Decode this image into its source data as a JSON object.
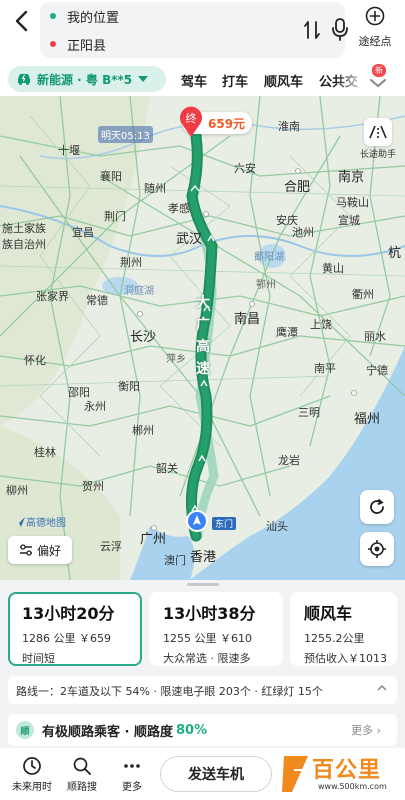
{
  "search": {
    "origin": "我的位置",
    "destination": "正阳县",
    "waypoint_label": "途经点"
  },
  "modes": {
    "vehicle": "新能源 · 粤 B**5",
    "tabs": [
      "驾车",
      "打车",
      "顺风车",
      "公共交"
    ],
    "badge": "新"
  },
  "map": {
    "weather": "明天05:13",
    "dest_tag": "659元",
    "dest_pin_char": "终",
    "long_help": "长途助手",
    "highway": [
      "大",
      "广",
      "高",
      "速"
    ],
    "pref_label": "偏好",
    "amap_logo": "高德地图",
    "dongmen": "东门",
    "cities": [
      {
        "name": "淮南",
        "cls": "city"
      },
      {
        "name": "十堰",
        "cls": "city"
      },
      {
        "name": "随州",
        "cls": "city"
      },
      {
        "name": "襄阳",
        "cls": "city"
      },
      {
        "name": "孝感",
        "cls": "city"
      },
      {
        "name": "六安",
        "cls": "city"
      },
      {
        "name": "合肥",
        "cls": "city big"
      },
      {
        "name": "南京",
        "cls": "city big"
      },
      {
        "name": "马鞍山",
        "cls": "city"
      },
      {
        "name": "荆门",
        "cls": "city"
      },
      {
        "name": "施土家族",
        "cls": "city"
      },
      {
        "name": "族自治州",
        "cls": "city"
      },
      {
        "name": "宜昌",
        "cls": "city"
      },
      {
        "name": "武汉",
        "cls": "city big"
      },
      {
        "name": "安庆",
        "cls": "city"
      },
      {
        "name": "池州",
        "cls": "city"
      },
      {
        "name": "宣城",
        "cls": "city"
      },
      {
        "name": "杭",
        "cls": "city big"
      },
      {
        "name": "荆州",
        "cls": "city"
      },
      {
        "name": "鄂州",
        "cls": "city small"
      },
      {
        "name": "黄山",
        "cls": "city"
      },
      {
        "name": "张家界",
        "cls": "city"
      },
      {
        "name": "常德",
        "cls": "city"
      },
      {
        "name": "洞庭湖",
        "cls": "city water"
      },
      {
        "name": "鄱阳湖",
        "cls": "city water"
      },
      {
        "name": "衢州",
        "cls": "city"
      },
      {
        "name": "南昌",
        "cls": "city big"
      },
      {
        "name": "上饶",
        "cls": "city"
      },
      {
        "name": "怀化",
        "cls": "city"
      },
      {
        "name": "长沙",
        "cls": "city big"
      },
      {
        "name": "鹰潭",
        "cls": "city"
      },
      {
        "name": "丽水",
        "cls": "city"
      },
      {
        "name": "萍乡",
        "cls": "city small"
      },
      {
        "name": "南平",
        "cls": "city"
      },
      {
        "name": "宁德",
        "cls": "city"
      },
      {
        "name": "衡阳",
        "cls": "city"
      },
      {
        "name": "邵阳",
        "cls": "city"
      },
      {
        "name": "永州",
        "cls": "city"
      },
      {
        "name": "三明",
        "cls": "city"
      },
      {
        "name": "福州",
        "cls": "city big"
      },
      {
        "name": "郴州",
        "cls": "city"
      },
      {
        "name": "桂林",
        "cls": "city"
      },
      {
        "name": "韶关",
        "cls": "city"
      },
      {
        "name": "龙岩",
        "cls": "city"
      },
      {
        "name": "贺州",
        "cls": "city"
      },
      {
        "name": "柳州",
        "cls": "city"
      },
      {
        "name": "广州",
        "cls": "city big"
      },
      {
        "name": "汕头",
        "cls": "city"
      },
      {
        "name": "云浮",
        "cls": "city"
      },
      {
        "name": "香港",
        "cls": "city big"
      },
      {
        "name": "澳门",
        "cls": "city"
      }
    ]
  },
  "options": [
    {
      "time": "13小时20分",
      "distance": "1286 公里 ￥659",
      "tag": "时间短"
    },
    {
      "time": "13小时38分",
      "distance": "1255 公里 ￥610",
      "tag": "大众常选 · 限速多"
    },
    {
      "time": "顺风车",
      "distance": "1255.2公里",
      "tag": "预估收入￥1013"
    }
  ],
  "route_info": "路线一：2车道及以下 54% · 限速电子眼 203个 · 红绿灯 15个",
  "promo": {
    "badge": "顺",
    "text": "有极顺路乘客 · 顺路度",
    "pct": "80%",
    "more": "更多"
  },
  "actions": {
    "later": "未来用时",
    "search_along": "顺路搜",
    "more": "更多",
    "send": "发送车机"
  },
  "watermark": {
    "text": "百公里",
    "url": "www.500km.com"
  }
}
